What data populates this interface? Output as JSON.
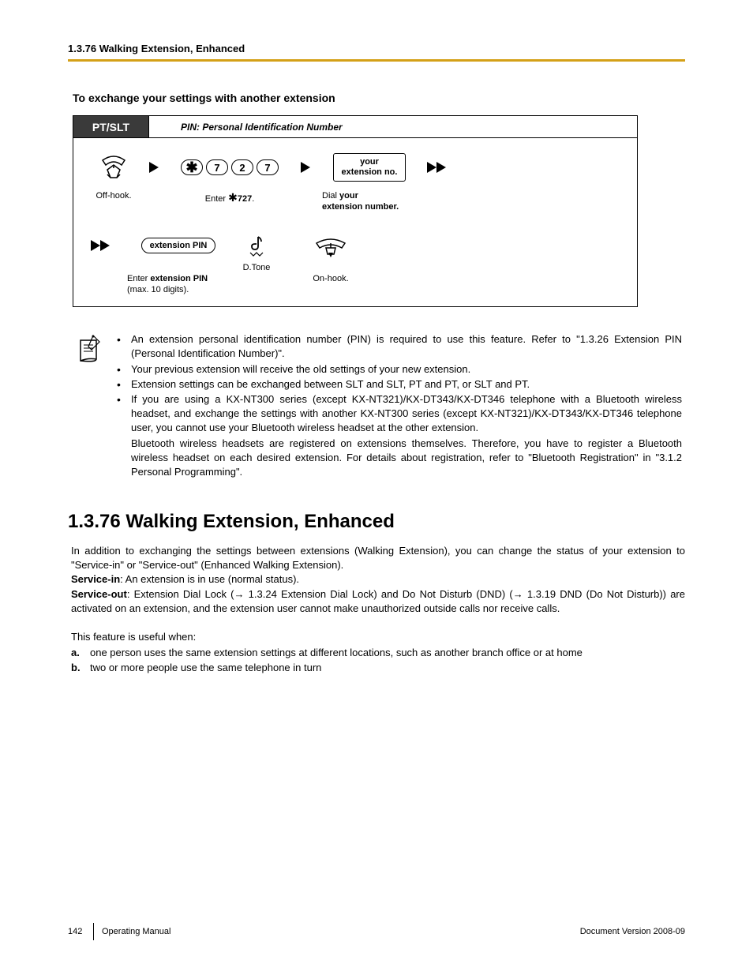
{
  "header": {
    "running_head": "1.3.76 Walking Extension, Enhanced"
  },
  "subsection": {
    "title": "To exchange your settings with another extension"
  },
  "procedure": {
    "device_label": "PT/SLT",
    "header_note": "PIN: Personal Identification Number",
    "row1": {
      "offhook_label": "Off-hook.",
      "key1": "7",
      "key2": "2",
      "key3": "7",
      "enter_label_prefix": "Enter ",
      "enter_label_code": "727",
      "enter_label_suffix": ".",
      "ext_box_line1": "your",
      "ext_box_line2": "extension no.",
      "dial_label_prefix": "Dial ",
      "dial_label_bold": "your",
      "dial_label_line2": "extension number."
    },
    "row2": {
      "pin_box": "extension PIN",
      "pin_label_prefix": "Enter ",
      "pin_label_bold": "extension PIN",
      "pin_label_line2": "(max. 10 digits).",
      "dtone_label": "D.Tone",
      "onhook_label": "On-hook."
    }
  },
  "notes": {
    "items": [
      "An extension personal identification number (PIN) is required to use this feature. Refer to \"1.3.26  Extension PIN (Personal Identification Number)\".",
      "Your previous extension will receive the old settings of your new extension.",
      "Extension settings can be exchanged between SLT and SLT, PT and PT, or SLT and PT.",
      "If you are using a KX-NT300 series (except KX-NT321)/KX-DT343/KX-DT346 telephone with a Bluetooth wireless headset, and exchange the settings with another KX-NT300 series (except KX-NT321)/KX-DT343/KX-DT346 telephone user, you cannot use your Bluetooth wireless headset at the other extension."
    ],
    "continuation": "Bluetooth wireless headsets are registered on extensions themselves. Therefore, you have to register a Bluetooth wireless headset on each desired extension. For details about registration, refer to \"Bluetooth Registration\" in \"3.1.2  Personal Programming\"."
  },
  "section": {
    "title": "1.3.76  Walking Extension, Enhanced",
    "para1": "In addition to exchanging the settings between extensions (Walking Extension), you can change the status of your extension to \"Service-in\" or \"Service-out\" (Enhanced Walking Extension).",
    "service_in_label": "Service-in",
    "service_in_text": ": An extension is in use (normal status).",
    "service_out_label": "Service-out",
    "service_out_text_a": ": Extension Dial Lock (",
    "service_out_ref1": " 1.3.24  Extension Dial Lock) and Do Not Disturb (DND) (",
    "service_out_ref2": " 1.3.19  DND (Do Not Disturb)) are activated on an extension, and the extension user cannot make unauthorized outside calls nor receive calls.",
    "para2": "This feature is useful when:",
    "list": [
      {
        "marker": "a.",
        "text": "one person uses the same extension settings at different locations, such as another branch office or at home"
      },
      {
        "marker": "b.",
        "text": "two or more people use the same telephone in turn"
      }
    ]
  },
  "footer": {
    "page": "142",
    "manual": "Operating Manual",
    "doc_version": "Document Version  2008-09"
  }
}
